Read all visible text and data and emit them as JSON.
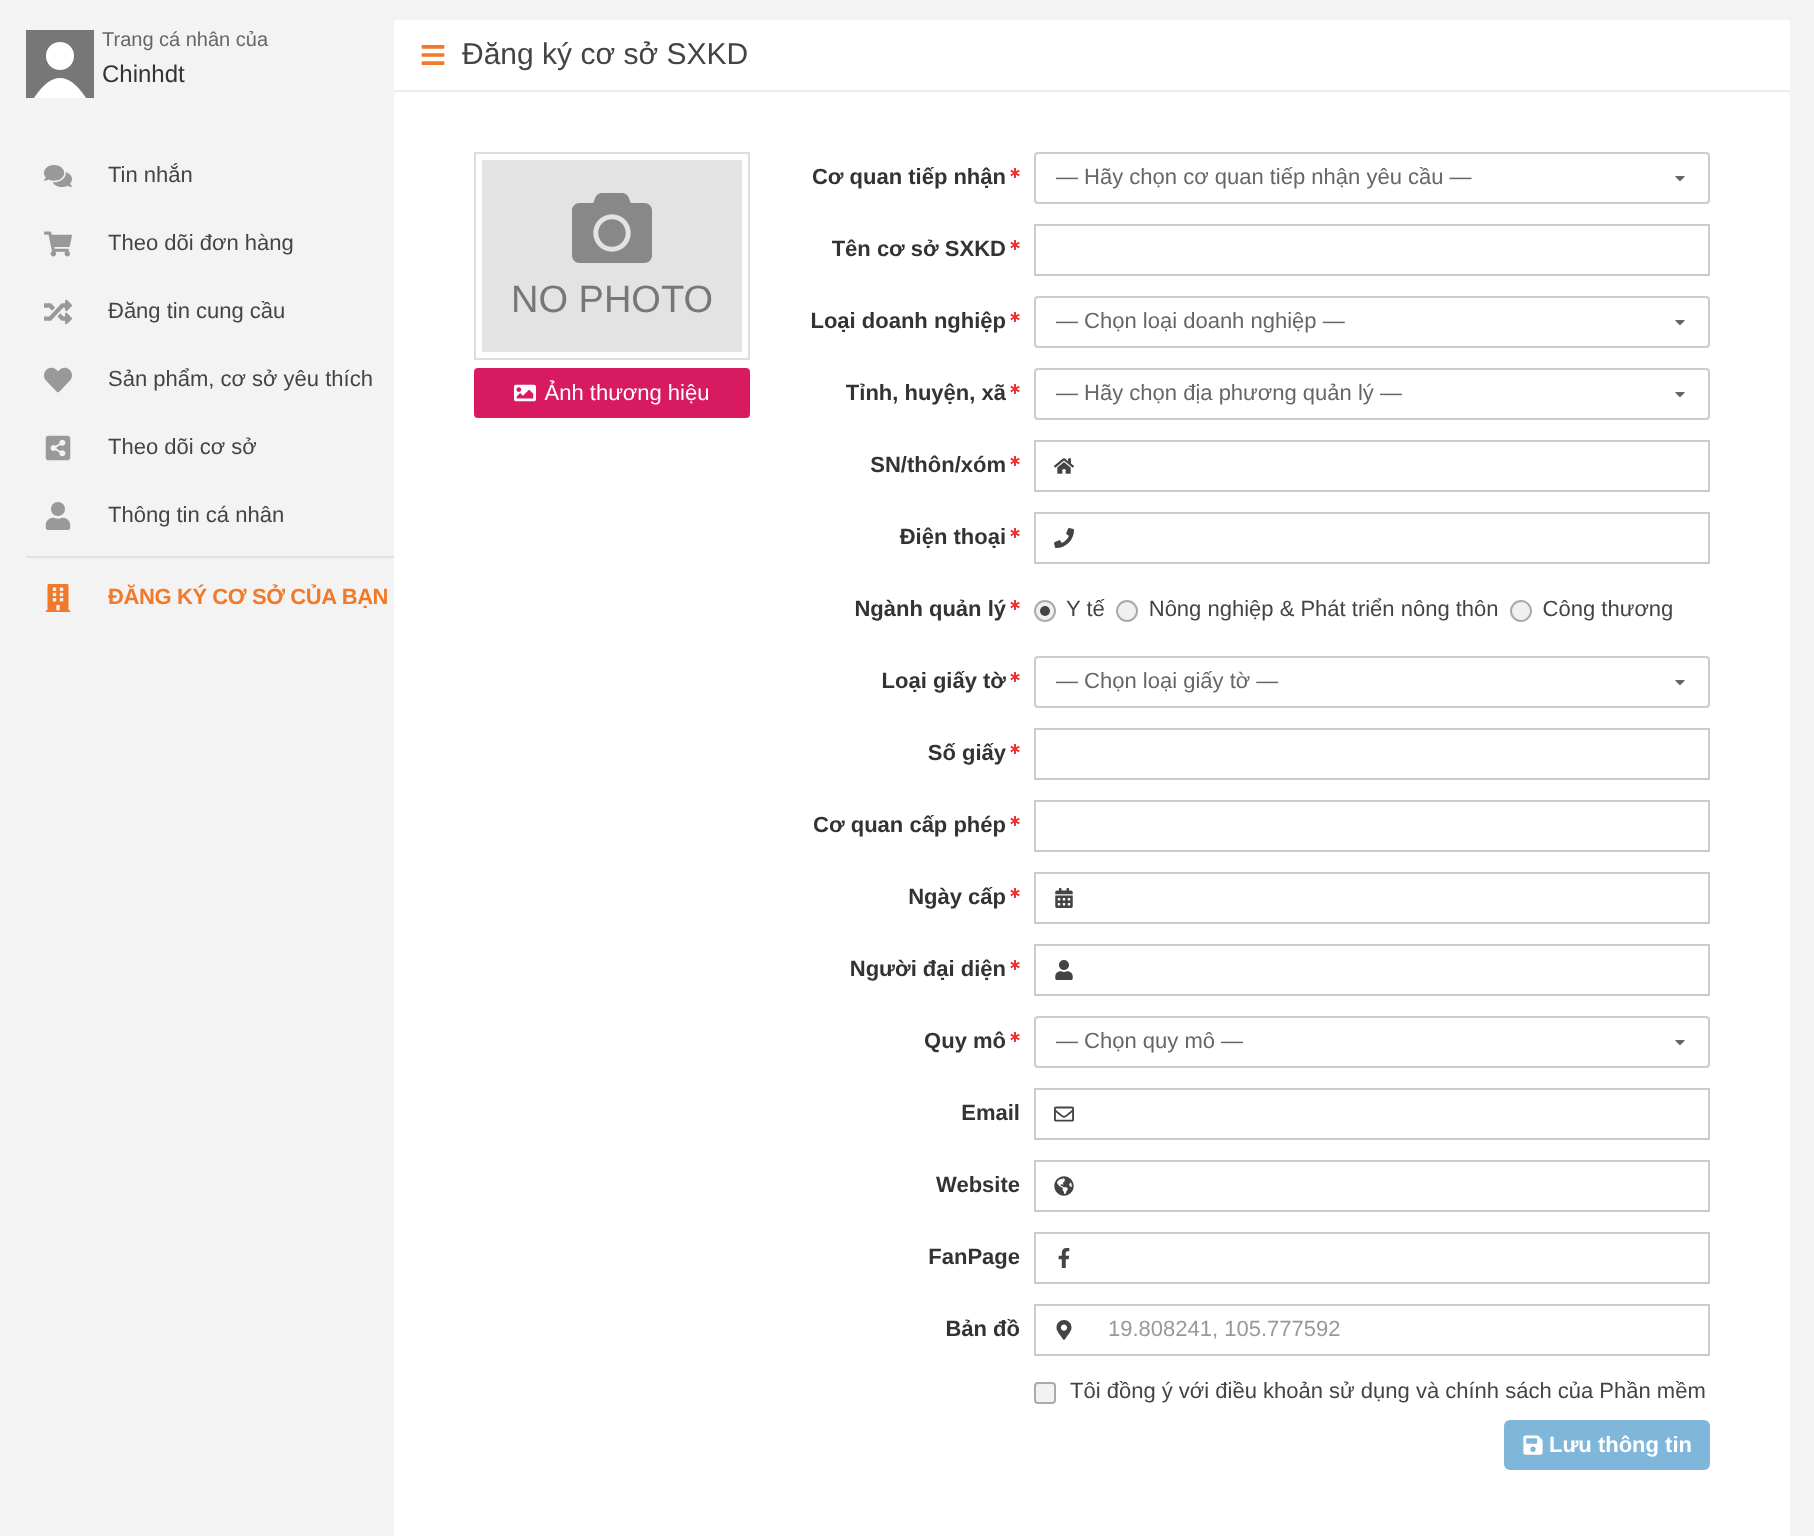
{
  "sidebar": {
    "profile": {
      "caption": "Trang cá nhân của",
      "name": "Chinhdt"
    },
    "items": [
      {
        "label": "Tin nhắn",
        "selected": false
      },
      {
        "label": "Theo dõi đơn hàng",
        "selected": false
      },
      {
        "label": "Đăng tin cung cầu",
        "selected": false
      },
      {
        "label": "Sản phẩm, cơ sở yêu thích",
        "selected": false
      },
      {
        "label": "Theo dõi cơ sở",
        "selected": false
      },
      {
        "label": "Thông tin cá nhân",
        "selected": false
      }
    ],
    "footer_item": {
      "label": "ĐĂNG KÝ CƠ SỞ CỦA BẠN",
      "selected": true
    }
  },
  "panel": {
    "title": "Đăng ký cơ sở SXKD"
  },
  "photo": {
    "text": "NO PHOTO",
    "button": "Ảnh thương hiệu"
  },
  "fields": [
    {
      "label": "Cơ quan tiếp nhận",
      "required": true,
      "kind": "select",
      "placeholder": "— Hãy chọn cơ quan tiếp nhận yêu cầu —"
    },
    {
      "label": "Tên cơ sở SXKD",
      "required": true,
      "kind": "text"
    },
    {
      "label": "Loại doanh nghiệp",
      "required": true,
      "kind": "select",
      "placeholder": "— Chọn loại doanh nghiệp —"
    },
    {
      "label": "Tỉnh, huyện, xã",
      "required": true,
      "kind": "select",
      "placeholder": "— Hãy chọn địa phương quản lý —"
    },
    {
      "label": "SN/thôn/xóm",
      "required": true,
      "kind": "icon"
    },
    {
      "label": "Điện thoại",
      "required": true,
      "kind": "icon"
    },
    {
      "label": "Ngành quản lý",
      "required": true,
      "kind": "radio",
      "options": [
        {
          "label": "Y tế",
          "selected": true
        },
        {
          "label": "Nông nghiệp & Phát triển nông thôn",
          "selected": false
        },
        {
          "label": "Công thương",
          "selected": false
        }
      ]
    },
    {
      "label": "Loại giấy tờ",
      "required": true,
      "kind": "select",
      "placeholder": "— Chọn loại giấy tờ —"
    },
    {
      "label": "Số giấy",
      "required": true,
      "kind": "text"
    },
    {
      "label": "Cơ quan cấp phép",
      "required": true,
      "kind": "text"
    },
    {
      "label": "Ngày cấp",
      "required": true,
      "kind": "icon"
    },
    {
      "label": "Người đại diện",
      "required": true,
      "kind": "icon"
    },
    {
      "label": "Quy mô",
      "required": true,
      "kind": "select",
      "placeholder": "— Chọn quy mô —"
    },
    {
      "label": "Email",
      "required": false,
      "kind": "icon"
    },
    {
      "label": "Website",
      "required": false,
      "kind": "icon"
    },
    {
      "label": "FanPage",
      "required": false,
      "kind": "icon"
    },
    {
      "label": "Bản đồ",
      "required": false,
      "kind": "icon",
      "placeholder": "19.808241, 105.777592"
    }
  ],
  "agreement": {
    "label": "Tôi đồng ý với điều khoản sử dụng và chính sách của Phần mềm",
    "checked": false
  },
  "save_button": {
    "label": "Lưu thông tin",
    "disabled": true
  }
}
